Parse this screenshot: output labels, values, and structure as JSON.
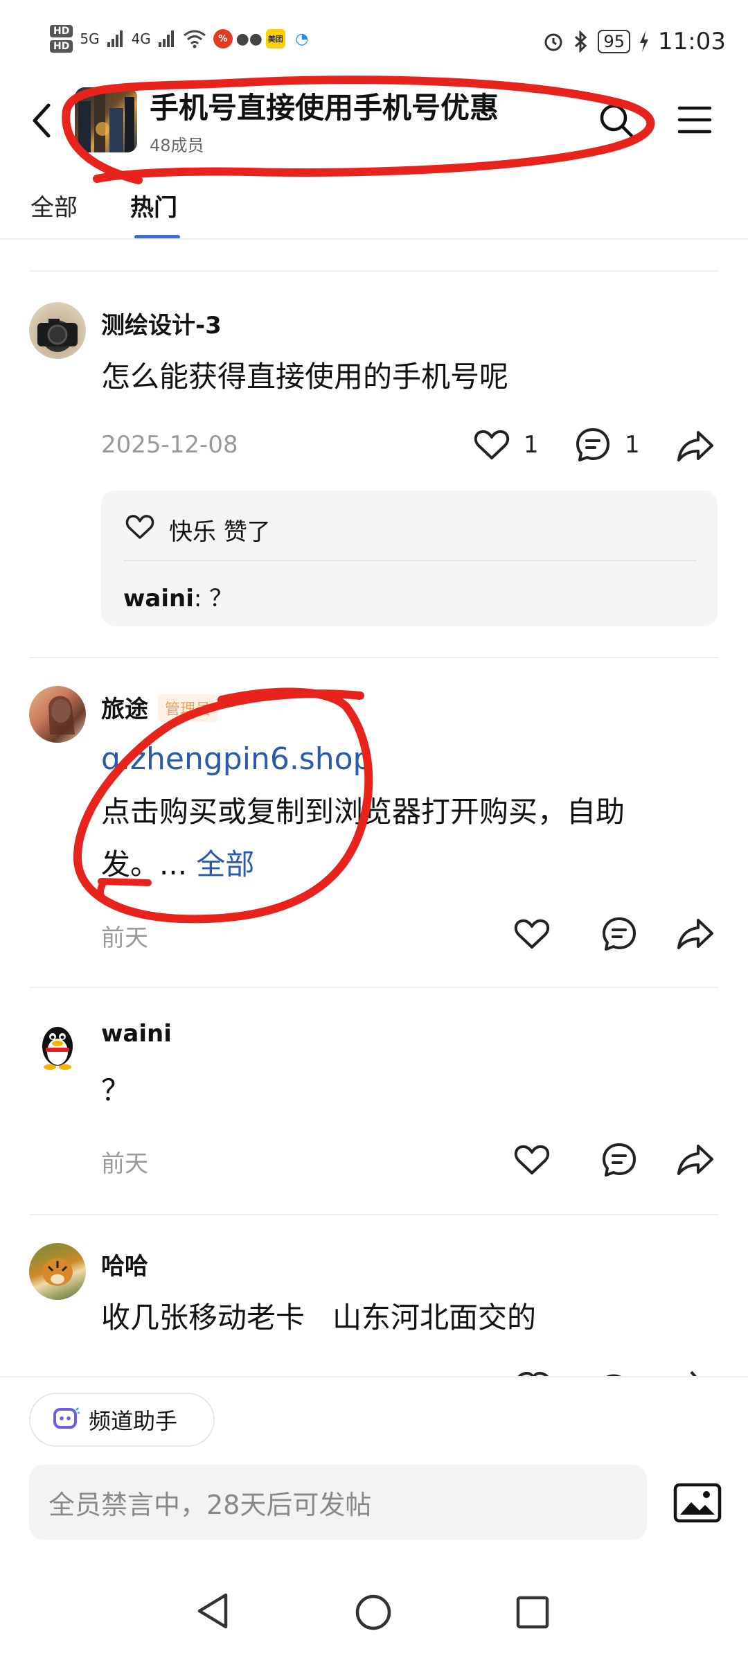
{
  "status_bar": {
    "time": "11:03",
    "battery": "95",
    "network_1": "5G",
    "network_2": "4G",
    "hd_1": "HD",
    "hd_2": "HD",
    "app_chip_meituan": "美团"
  },
  "header": {
    "title": "手机号直接使用手机号优惠",
    "member_count": "48成员"
  },
  "tabs": [
    {
      "label": "全部"
    },
    {
      "label": "热门"
    }
  ],
  "posts": [
    {
      "author": "测绘设计-3",
      "body": "怎么能获得直接使用的手机号呢",
      "date": "2025-12-08",
      "likes": "1",
      "comments": "1",
      "liked_by_name": "快乐",
      "liked_by_suffix": "赞了",
      "reply_author": "waini",
      "reply_text": ": ？"
    },
    {
      "author": "旅途",
      "badge": "管理员",
      "link": "q.zhengpin6.shop",
      "body_line1": "点击购买或复制到浏览器打开购买，自助",
      "body_line2": "发。...",
      "more": "全部",
      "date": "前天"
    },
    {
      "author": "waini",
      "body": "？",
      "date": "前天"
    },
    {
      "author": "哈哈",
      "body": "收几张移动老卡   山东河北面交的"
    }
  ],
  "bottom": {
    "helper_label": "频道助手",
    "input_placeholder": "全员禁言中，28天后可发帖"
  },
  "colors": {
    "accent": "#3a6be6",
    "link": "#2b5aad",
    "annotation": "#e8231b"
  }
}
